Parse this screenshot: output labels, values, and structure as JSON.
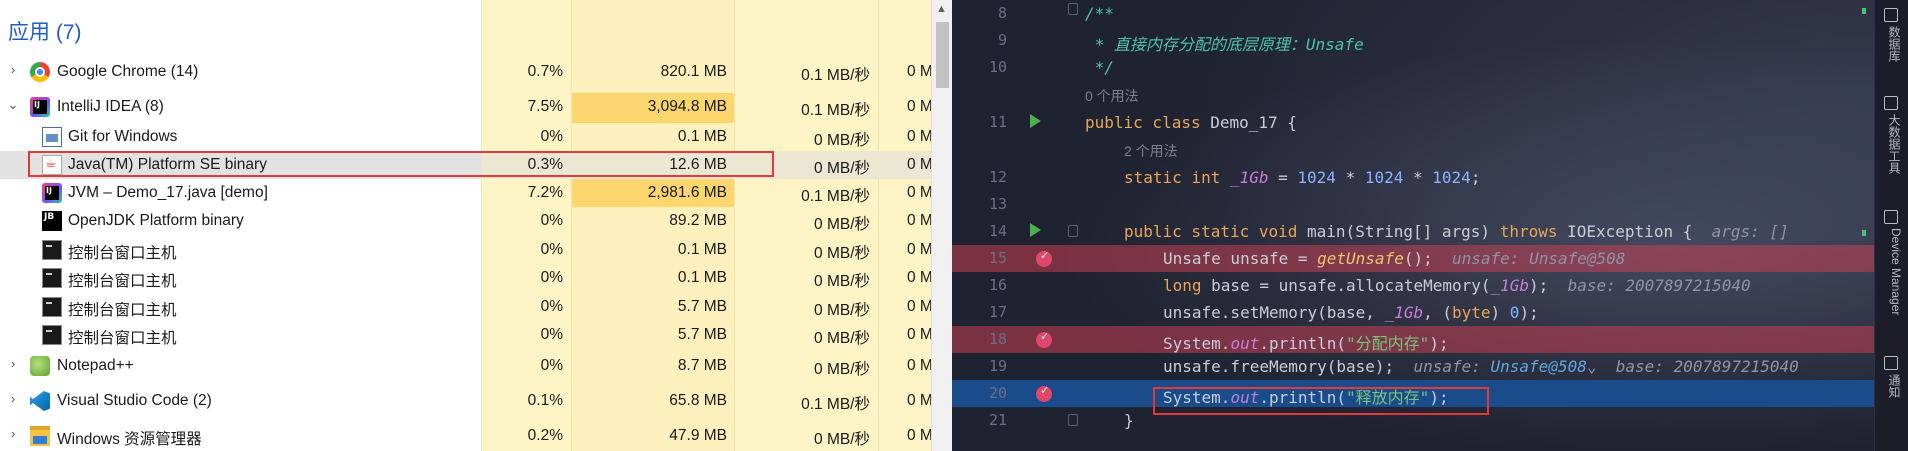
{
  "task_manager": {
    "group_title": "应用 (7)",
    "rows": [
      {
        "name": "Google Chrome (14)",
        "icon": "chrome-icon",
        "expand": "collapsed",
        "cpu": "0.7%",
        "mem": "820.1 MB",
        "disk": "0.1 MB/秒",
        "net": "0 M"
      },
      {
        "name": "IntelliJ IDEA (8)",
        "icon": "intellij-icon",
        "expand": "expanded",
        "cpu": "7.5%",
        "mem": "3,094.8 MB",
        "disk": "0.1 MB/秒",
        "net": "0 M"
      },
      {
        "name": "Git for Windows",
        "icon": "git-icon",
        "expand": "none",
        "cpu": "0%",
        "mem": "0.1 MB",
        "disk": "0 MB/秒",
        "net": "0 M"
      },
      {
        "name": "Java(TM) Platform SE binary",
        "icon": "java-icon",
        "expand": "none",
        "cpu": "0.3%",
        "mem": "12.6 MB",
        "disk": "0 MB/秒",
        "net": "0 M",
        "selected": true
      },
      {
        "name": "JVM – Demo_17.java [demo]",
        "icon": "intellij-icon",
        "expand": "none",
        "cpu": "7.2%",
        "mem": "2,981.6 MB",
        "disk": "0.1 MB/秒",
        "net": "0 M"
      },
      {
        "name": "OpenJDK Platform binary",
        "icon": "jetbrains-icon",
        "expand": "none",
        "cpu": "0%",
        "mem": "89.2 MB",
        "disk": "0 MB/秒",
        "net": "0 M"
      },
      {
        "name": "控制台窗口主机",
        "icon": "console-icon",
        "expand": "none",
        "cpu": "0%",
        "mem": "0.1 MB",
        "disk": "0 MB/秒",
        "net": "0 M"
      },
      {
        "name": "控制台窗口主机",
        "icon": "console-icon",
        "expand": "none",
        "cpu": "0%",
        "mem": "0.1 MB",
        "disk": "0 MB/秒",
        "net": "0 M"
      },
      {
        "name": "控制台窗口主机",
        "icon": "console-icon",
        "expand": "none",
        "cpu": "0%",
        "mem": "5.7 MB",
        "disk": "0 MB/秒",
        "net": "0 M"
      },
      {
        "name": "控制台窗口主机",
        "icon": "console-icon",
        "expand": "none",
        "cpu": "0%",
        "mem": "5.7 MB",
        "disk": "0 MB/秒",
        "net": "0 M"
      },
      {
        "name": "Notepad++",
        "icon": "notepadpp-icon",
        "expand": "collapsed",
        "cpu": "0%",
        "mem": "8.7 MB",
        "disk": "0 MB/秒",
        "net": "0 M"
      },
      {
        "name": "Visual Studio Code (2)",
        "icon": "vscode-icon",
        "expand": "collapsed",
        "cpu": "0.1%",
        "mem": "65.8 MB",
        "disk": "0.1 MB/秒",
        "net": "0 M"
      },
      {
        "name": "Windows 资源管理器",
        "icon": "explorer-icon",
        "expand": "collapsed",
        "cpu": "0.2%",
        "mem": "47.9 MB",
        "disk": "0 MB/秒",
        "net": "0 M"
      }
    ]
  },
  "ide": {
    "lines": {
      "l8": {
        "num": "8",
        "text": "/**"
      },
      "l9": {
        "num": "9",
        "text": " * 直接内存分配的底层原理：Unsafe"
      },
      "l10": {
        "num": "10",
        "text": " */"
      },
      "usage1": "0 个用法",
      "l11": {
        "num": "11",
        "kw": "public class",
        "rest": " Demo_17 {"
      },
      "usage2": "2 个用法",
      "l12": {
        "num": "12",
        "kw1": "static int",
        "field": "_1Gb",
        "eq": " = ",
        "n1": "1024",
        "op1": " * ",
        "n2": "1024",
        "op2": " * ",
        "n3": "1024",
        "end": ";"
      },
      "l13": {
        "num": "13"
      },
      "l14": {
        "num": "14",
        "kw1": "public static void",
        "mid": " main(String[] args) ",
        "kw2": "throws",
        "rest": " IOException {",
        "hint": "args: []"
      },
      "l15": {
        "num": "15",
        "pre": "Unsafe unsafe = ",
        "call": "getUnsafe",
        "post": "();",
        "hint": "unsafe: Unsafe@508"
      },
      "l16": {
        "num": "16",
        "kw": "long",
        "pre": " base = unsafe.allocateMemory(",
        "field": "_1Gb",
        "post": ");",
        "hint": "base: 2007897215040"
      },
      "l17": {
        "num": "17",
        "pre": "unsafe.setMemory(base, ",
        "field": "_1Gb",
        "mid": ", (",
        "kw": "byte",
        "mid2": ") ",
        "n": "0",
        "post": ");"
      },
      "l18": {
        "num": "18",
        "pre": "System.",
        "fld": "out",
        "mid": ".println(",
        "str": "\"分配内存\"",
        "post": ");"
      },
      "l19": {
        "num": "19",
        "pre": "unsafe.freeMemory(base);",
        "hint1": "unsafe: ",
        "hint1v": "Unsafe@508",
        "chev": "⌄",
        "hint2": "base: 2007897215040"
      },
      "l20": {
        "num": "20",
        "pre": "System.",
        "fld": "out",
        "mid": ".println(",
        "str": "\"释放内存\"",
        "post": ");"
      },
      "l21": {
        "num": "21",
        "text": "}"
      }
    },
    "toolbar": [
      "数据库",
      "大数据工具",
      "Device Manager",
      "通知"
    ]
  },
  "colors": {
    "breakpoint_line": "#8a3446",
    "exec_line": "#1a4c8c",
    "highlight_box": "#e23a3a"
  }
}
